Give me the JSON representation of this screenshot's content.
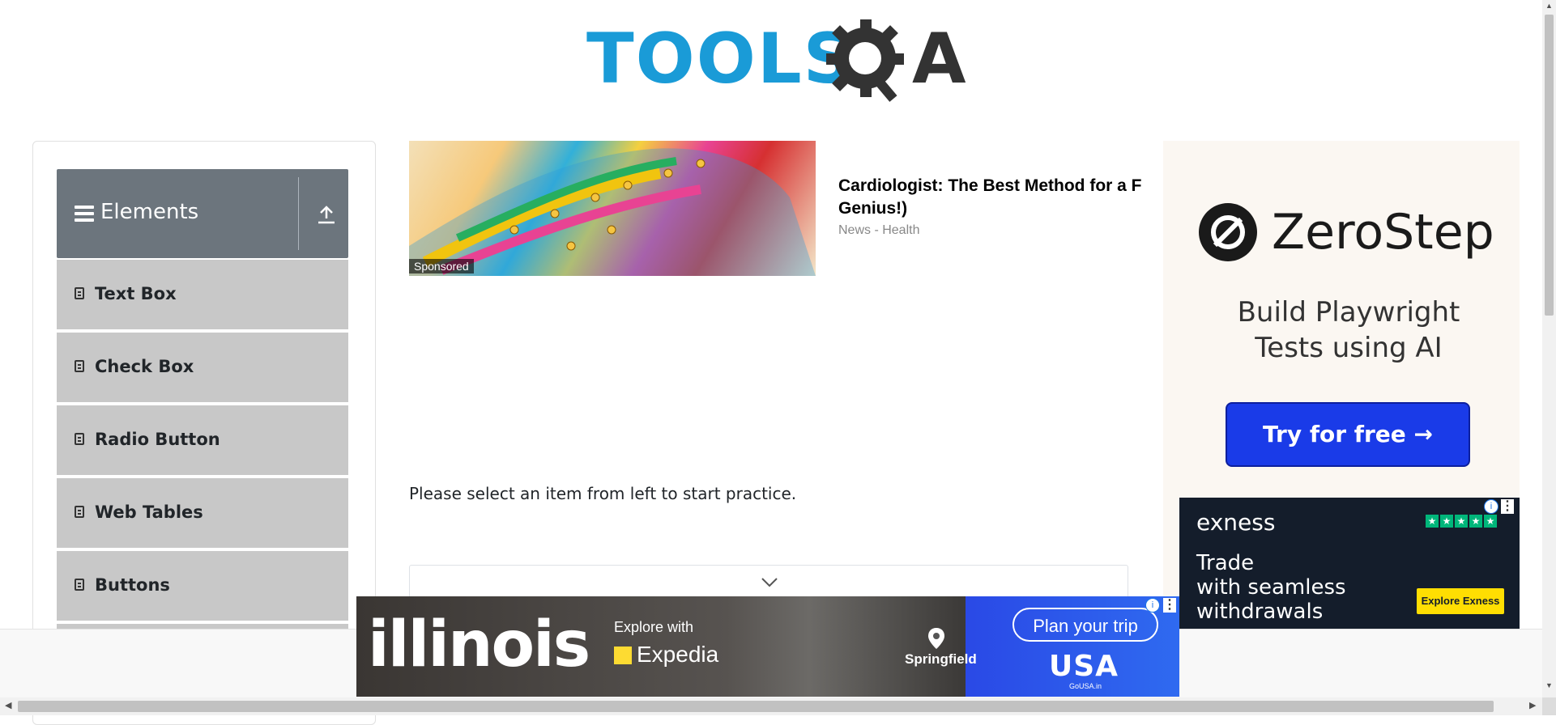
{
  "logo": {
    "text_left": "TOOLS",
    "text_right": "A"
  },
  "sidebar": {
    "group_title": "Elements",
    "items": [
      {
        "label": "Text Box"
      },
      {
        "label": "Check Box"
      },
      {
        "label": "Radio Button"
      },
      {
        "label": "Web Tables"
      },
      {
        "label": "Buttons"
      }
    ]
  },
  "sponsored_card": {
    "badge": "Sponsored",
    "title_line1": "Cardiologist: The Best Method for a F",
    "title_line2": "Genius!)",
    "source": "News - Health"
  },
  "main": {
    "practice_text": "Please select an item from left to start practice."
  },
  "right_ad": {
    "brand": "ZeroStep",
    "tagline_line1": "Build Playwright",
    "tagline_line2": "Tests using AI",
    "cta": "Try for free →"
  },
  "exness_ad": {
    "brand": "exness",
    "tagline_line1": "Trade",
    "tagline_line2": "with seamless",
    "tagline_line3": "withdrawals",
    "cta": "Explore Exness"
  },
  "banner_ad": {
    "brand": "illinois",
    "explore_with": "Explore with",
    "partner": "Expedia",
    "location": "Springfield",
    "cta": "Plan your trip",
    "usa": "USA",
    "gousa": "GoUSA.in"
  },
  "colors": {
    "brand_blue": "#1a9bd7",
    "sidebar_header": "#6c757d",
    "menu_item_bg": "#c8c8c8",
    "zerostep_button": "#1a3be8",
    "exness_bg": "#141d2b",
    "exness_button": "#ffde02"
  }
}
